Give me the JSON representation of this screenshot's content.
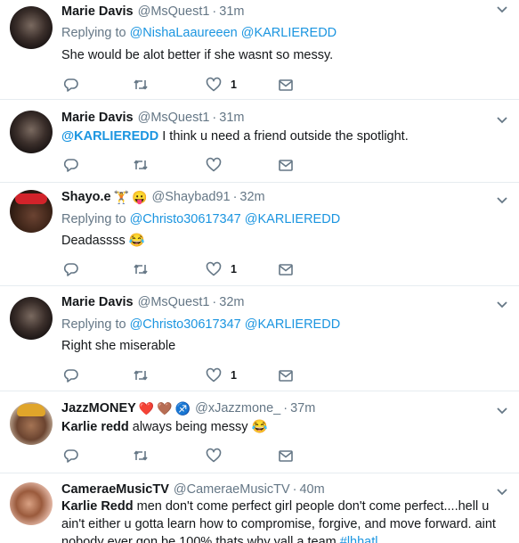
{
  "tweets": [
    {
      "name": "Marie Davis",
      "handle": "@MsQuest1",
      "time": "31m",
      "reply_prefix": "Replying to",
      "reply_1": "@NishaLaaureeen",
      "reply_2": "@KARLIEREDD",
      "text": "She would be alot better if she wasnt so messy.",
      "like_count": "1"
    },
    {
      "name": "Marie Davis",
      "handle": "@MsQuest1",
      "time": "31m",
      "mention": "@KARLIEREDD",
      "text": " I think u need a friend outside the spotlight.",
      "like_count": ""
    },
    {
      "name": "Shayo.e",
      "handle": "@Shaybad91",
      "time": "32m",
      "name_emojis": [
        "🏋",
        "😛"
      ],
      "reply_prefix": "Replying to",
      "reply_1": "@Christo30617347",
      "reply_2": "@KARLIEREDD",
      "text": "Deadassss 😂",
      "like_count": "1"
    },
    {
      "name": "Marie Davis",
      "handle": "@MsQuest1",
      "time": "32m",
      "reply_prefix": "Replying to",
      "reply_1": "@Christo30617347",
      "reply_2": "@KARLIEREDD",
      "text": "Right she miserable",
      "like_count": "1"
    },
    {
      "name": "JazzMONEY",
      "handle": "@xJazzmone_",
      "time": "37m",
      "name_emojis": [
        "❤️",
        "🤎",
        "♐"
      ],
      "bold_text": "Karlie redd",
      "text": " always being messy 😂",
      "like_count": ""
    },
    {
      "name": "CameraeMusicTV",
      "handle": "@CameraeMusicTV",
      "time": "40m",
      "bold_text": "Karlie Redd",
      "text": " men don't come perfect girl people don't come perfect....hell u ain't either u gotta learn how to compromise, forgive, and move forward. aint nobody ever gon be 100% thats why yall a team ",
      "hashtag": "#lhhatl"
    }
  ],
  "separator": "·"
}
